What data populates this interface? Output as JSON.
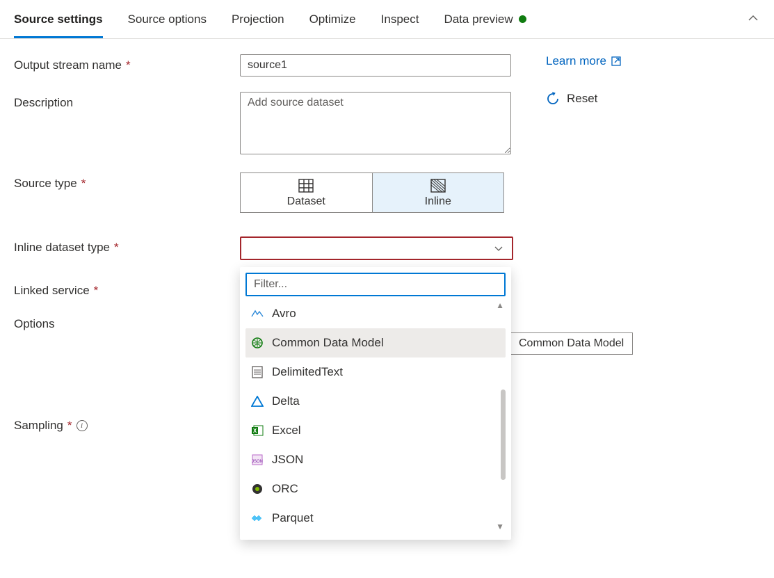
{
  "tabs": {
    "items": [
      {
        "label": "Source settings",
        "active": true
      },
      {
        "label": "Source options",
        "active": false
      },
      {
        "label": "Projection",
        "active": false
      },
      {
        "label": "Optimize",
        "active": false
      },
      {
        "label": "Inspect",
        "active": false
      },
      {
        "label": "Data preview",
        "active": false,
        "status_dot": true
      }
    ]
  },
  "form": {
    "output_stream_name": {
      "label": "Output stream name",
      "required": true,
      "value": "source1"
    },
    "description": {
      "label": "Description",
      "placeholder": "Add source dataset",
      "value": ""
    },
    "source_type": {
      "label": "Source type",
      "required": true,
      "options": [
        {
          "label": "Dataset",
          "icon": "dataset-icon",
          "selected": false
        },
        {
          "label": "Inline",
          "icon": "inline-icon",
          "selected": true
        }
      ]
    },
    "inline_dataset_type": {
      "label": "Inline dataset type",
      "required": true,
      "value": ""
    },
    "linked_service": {
      "label": "Linked service",
      "required": true
    },
    "options": {
      "label": "Options"
    },
    "sampling": {
      "label": "Sampling",
      "required": true
    }
  },
  "side": {
    "learn_more": "Learn more",
    "reset": "Reset"
  },
  "dropdown": {
    "filter_placeholder": "Filter...",
    "items": [
      {
        "label": "Avro",
        "icon": "avro-icon",
        "hover": false
      },
      {
        "label": "Common Data Model",
        "icon": "cdm-icon",
        "hover": true
      },
      {
        "label": "DelimitedText",
        "icon": "delimited-icon",
        "hover": false
      },
      {
        "label": "Delta",
        "icon": "delta-icon",
        "hover": false
      },
      {
        "label": "Excel",
        "icon": "excel-icon",
        "hover": false
      },
      {
        "label": "JSON",
        "icon": "json-icon",
        "hover": false
      },
      {
        "label": "ORC",
        "icon": "orc-icon",
        "hover": false
      },
      {
        "label": "Parquet",
        "icon": "parquet-icon",
        "hover": false
      }
    ],
    "tooltip": "Common Data Model"
  }
}
